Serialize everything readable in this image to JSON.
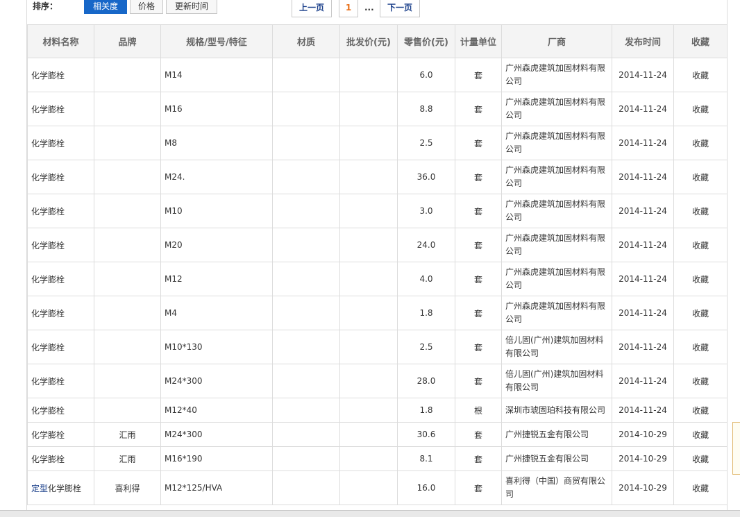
{
  "sort": {
    "label": "排序：",
    "options": [
      "相关度",
      "价格",
      "更新时间"
    ]
  },
  "pager": {
    "prev": "上一页",
    "current": "1",
    "dots": "...",
    "next": "下一页"
  },
  "table": {
    "headers": [
      "材料名称",
      "品牌",
      "规格/型号/特征",
      "材质",
      "批发价(元)",
      "零售价(元)",
      "计量单位",
      "厂商",
      "发布时间",
      "收藏"
    ],
    "rows": [
      {
        "prefix": "",
        "name": "化学膨栓",
        "brand": "",
        "spec": "M14",
        "material": "",
        "wholesale": "",
        "retail": "6.0",
        "unit": "套",
        "vendor": "广州森虎建筑加固材料有限公司",
        "date": "2014-11-24",
        "fav": "收藏"
      },
      {
        "prefix": "",
        "name": "化学膨栓",
        "brand": "",
        "spec": "M16",
        "material": "",
        "wholesale": "",
        "retail": "8.8",
        "unit": "套",
        "vendor": "广州森虎建筑加固材料有限公司",
        "date": "2014-11-24",
        "fav": "收藏"
      },
      {
        "prefix": "",
        "name": "化学膨栓",
        "brand": "",
        "spec": "M8",
        "material": "",
        "wholesale": "",
        "retail": "2.5",
        "unit": "套",
        "vendor": "广州森虎建筑加固材料有限公司",
        "date": "2014-11-24",
        "fav": "收藏"
      },
      {
        "prefix": "",
        "name": "化学膨栓",
        "brand": "",
        "spec": "M24.",
        "material": "",
        "wholesale": "",
        "retail": "36.0",
        "unit": "套",
        "vendor": "广州森虎建筑加固材料有限公司",
        "date": "2014-11-24",
        "fav": "收藏"
      },
      {
        "prefix": "",
        "name": "化学膨栓",
        "brand": "",
        "spec": "M10",
        "material": "",
        "wholesale": "",
        "retail": "3.0",
        "unit": "套",
        "vendor": "广州森虎建筑加固材料有限公司",
        "date": "2014-11-24",
        "fav": "收藏"
      },
      {
        "prefix": "",
        "name": "化学膨栓",
        "brand": "",
        "spec": "M20",
        "material": "",
        "wholesale": "",
        "retail": "24.0",
        "unit": "套",
        "vendor": "广州森虎建筑加固材料有限公司",
        "date": "2014-11-24",
        "fav": "收藏"
      },
      {
        "prefix": "",
        "name": "化学膨栓",
        "brand": "",
        "spec": "M12",
        "material": "",
        "wholesale": "",
        "retail": "4.0",
        "unit": "套",
        "vendor": "广州森虎建筑加固材料有限公司",
        "date": "2014-11-24",
        "fav": "收藏"
      },
      {
        "prefix": "",
        "name": "化学膨栓",
        "brand": "",
        "spec": "M4",
        "material": "",
        "wholesale": "",
        "retail": "1.8",
        "unit": "套",
        "vendor": "广州森虎建筑加固材料有限公司",
        "date": "2014-11-24",
        "fav": "收藏"
      },
      {
        "prefix": "",
        "name": "化学膨栓",
        "brand": "",
        "spec": "M10*130",
        "material": "",
        "wholesale": "",
        "retail": "2.5",
        "unit": "套",
        "vendor": "倍儿固(广州)建筑加固材料有限公司",
        "date": "2014-11-24",
        "fav": "收藏"
      },
      {
        "prefix": "",
        "name": "化学膨栓",
        "brand": "",
        "spec": "M24*300",
        "material": "",
        "wholesale": "",
        "retail": "28.0",
        "unit": "套",
        "vendor": "倍儿固(广州)建筑加固材料有限公司",
        "date": "2014-11-24",
        "fav": "收藏"
      },
      {
        "prefix": "",
        "name": "化学膨栓",
        "brand": "",
        "spec": "M12*40",
        "material": "",
        "wholesale": "",
        "retail": "1.8",
        "unit": "根",
        "vendor": "深圳市琥固珀科技有限公司",
        "date": "2014-11-24",
        "fav": "收藏",
        "short": true
      },
      {
        "prefix": "",
        "name": "化学膨栓",
        "brand": "汇雨",
        "spec": "M24*300",
        "material": "",
        "wholesale": "",
        "retail": "30.6",
        "unit": "套",
        "vendor": "广州捷锐五金有限公司",
        "date": "2014-10-29",
        "fav": "收藏",
        "short": true
      },
      {
        "prefix": "",
        "name": "化学膨栓",
        "brand": "汇雨",
        "spec": "M16*190",
        "material": "",
        "wholesale": "",
        "retail": "8.1",
        "unit": "套",
        "vendor": "广州捷锐五金有限公司",
        "date": "2014-10-29",
        "fav": "收藏",
        "short": true
      },
      {
        "prefix": "定型",
        "name": "化学膨栓",
        "brand": "喜利得",
        "spec": "M12*125/HVA",
        "material": "",
        "wholesale": "",
        "retail": "16.0",
        "unit": "套",
        "vendor": "喜利得（中国）商贸有限公司",
        "date": "2014-10-29",
        "fav": "收藏"
      }
    ]
  }
}
